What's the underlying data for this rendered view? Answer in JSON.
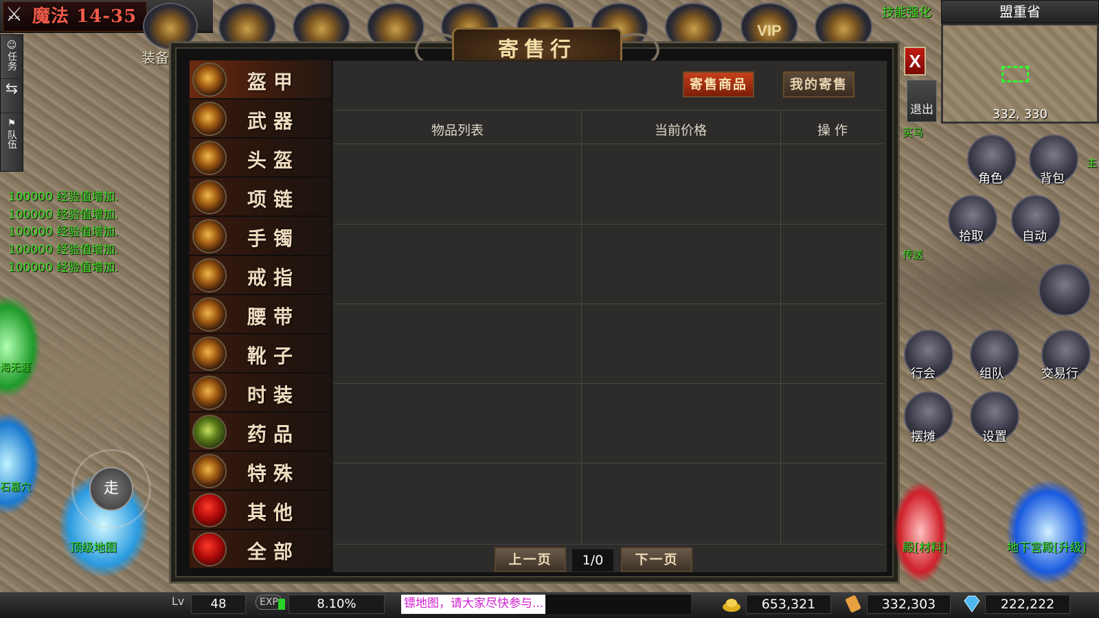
{
  "topbar": {
    "magic": "魔法 14-35",
    "equip": "装备",
    "vip": "VIP",
    "skill_enhance": "技能强化"
  },
  "left_menu": [
    {
      "label": "任务"
    },
    {
      "label": "队伍"
    }
  ],
  "exp_messages": [
    "100000 经验值增加.",
    "100000 经验值增加.",
    "100000 经验值增加.",
    "100000 经验值增加.",
    "100000 经验值增加."
  ],
  "left_labels": {
    "l1": "海无涯",
    "l2": "石墓穴",
    "walk": "走",
    "top_map": "顶级地图"
  },
  "panel": {
    "title": "寄售行",
    "close": "X",
    "tabs": [
      {
        "label": "寄售商品",
        "active": true
      },
      {
        "label": "我的寄售",
        "active": false
      }
    ],
    "columns": [
      "物品列表",
      "当前价格",
      "操  作"
    ],
    "categories": [
      {
        "label": "盔甲",
        "active": true
      },
      {
        "label": "武器"
      },
      {
        "label": "头盔"
      },
      {
        "label": "项链"
      },
      {
        "label": "手镯"
      },
      {
        "label": "戒指"
      },
      {
        "label": "腰带"
      },
      {
        "label": "靴子"
      },
      {
        "label": "时装"
      },
      {
        "label": "药品"
      },
      {
        "label": "特殊"
      },
      {
        "label": "其他"
      },
      {
        "label": "全部"
      }
    ],
    "pager": {
      "prev": "上一页",
      "page": "1/0",
      "next": "下一页"
    }
  },
  "right": {
    "region": "盟重省",
    "coords": "332, 330",
    "exit": "退出",
    "buy_horse": "买马",
    "teleport": "传送",
    "main": "主",
    "buttons": {
      "role": "角色",
      "bag": "背包",
      "pickup": "拾取",
      "auto": "自动",
      "guild": "行会",
      "team": "组队",
      "trade": "交易行",
      "stall": "摆摊",
      "settings": "设置"
    },
    "material": "殿[材料]",
    "palace": "地下宫殿[升级]"
  },
  "bottom": {
    "lv_label": "Lv",
    "level": "48",
    "exp_label": "EXP",
    "exp_percent": "8.10%",
    "notice": "镖地图，请大家尽快参与...",
    "gold": "653,321",
    "scroll": "332,303",
    "diamond": "222,222"
  },
  "colors": {
    "accent": "#c6401a",
    "exp_green": "#39e021",
    "notice": "#d020d0"
  }
}
